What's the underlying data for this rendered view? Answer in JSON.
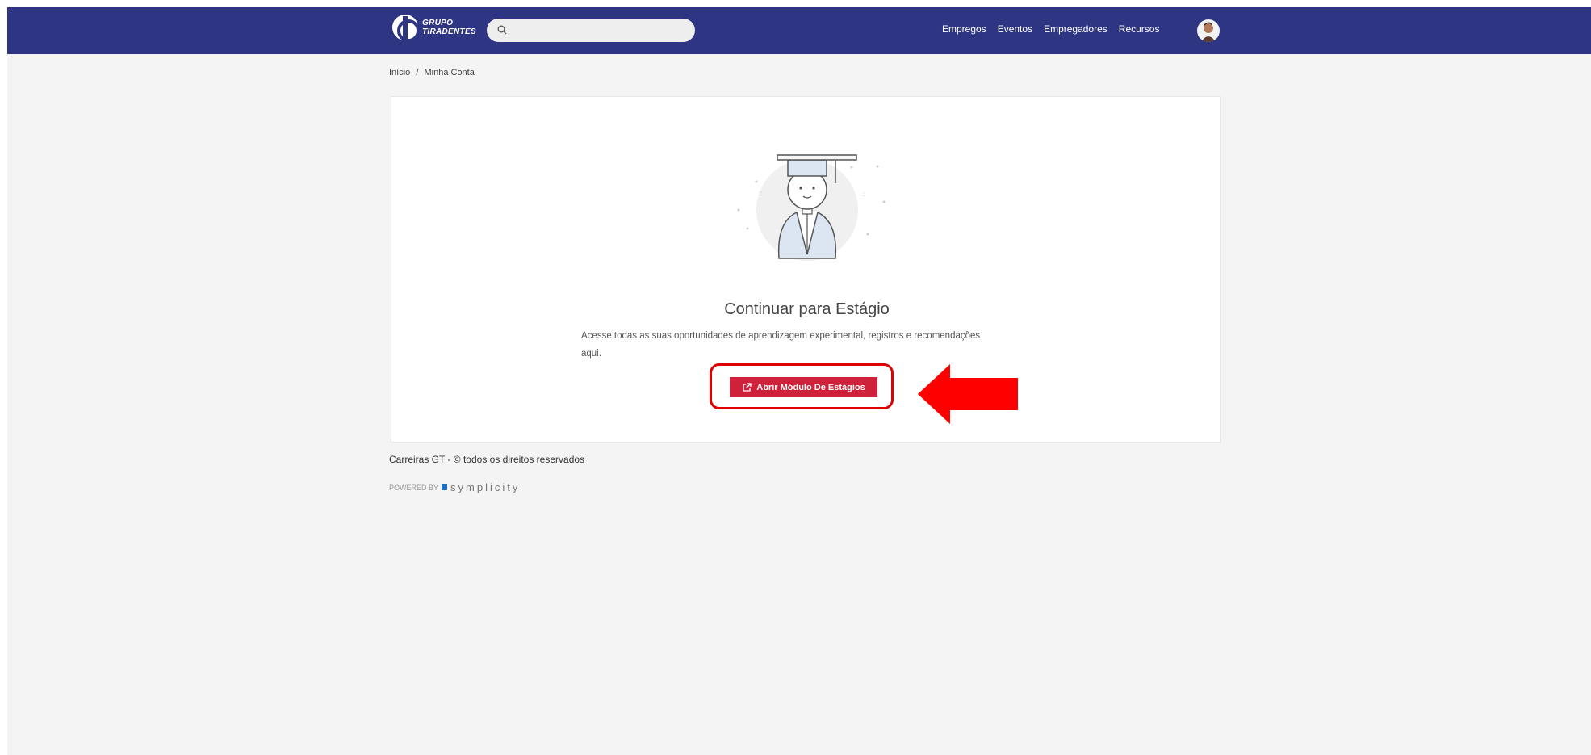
{
  "header": {
    "logo_line1": "GRUPO",
    "logo_line2": "TIRADENTES",
    "search_placeholder": "",
    "nav": [
      "Empregos",
      "Eventos",
      "Empregadores",
      "Recursos"
    ]
  },
  "breadcrumb": {
    "home": "Início",
    "separator": "/",
    "current": "Minha Conta"
  },
  "card": {
    "title": "Continuar para Estágio",
    "description": "Acesse todas as suas oportunidades de aprendizagem experimental, registros e recomendações aqui.",
    "button_label": "Abrir Módulo De Estágios",
    "button_icon": "external-link-icon",
    "illustration": "graduate-icon"
  },
  "footer": {
    "copyright": "Carreiras GT - © todos os direitos reservados",
    "powered_by": "POWERED BY",
    "brand": "symplicity"
  },
  "colors": {
    "topbar": "#2e3582",
    "button": "#d0213a",
    "highlight": "#e00000",
    "page_bg": "#f4f4f4"
  }
}
